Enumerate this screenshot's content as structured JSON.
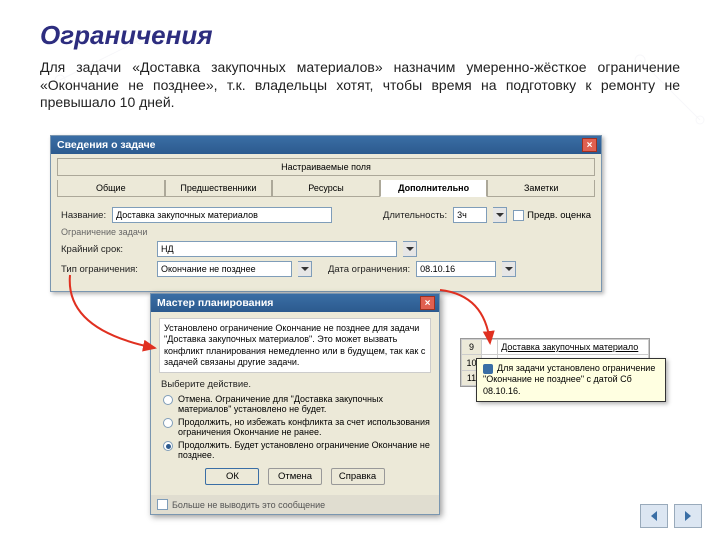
{
  "slide": {
    "title": "Ограничения",
    "subtitle": "Для задачи «Доставка закупочных материалов» назначим умеренно-жёсткое ограничение «Окончание не позднее», т.к. владельцы хотят, чтобы время на подготовку к ремонту не превышало 10 дней."
  },
  "taskDialog": {
    "title": "Сведения о задаче",
    "tabs": {
      "custom": "Настраиваемые поля",
      "general": "Общие",
      "pred": "Предшественники",
      "res": "Ресурсы",
      "adv": "Дополнительно",
      "notes": "Заметки"
    },
    "labels": {
      "name": "Название:",
      "duration": "Длительность:",
      "duration_val": "3ч",
      "pred_chk": "Предв. оценка",
      "group": "Ограничение задачи",
      "deadline": "Крайний срок:",
      "deadline_val": "НД",
      "ctype": "Тип ограничения:",
      "ctype_val": "Окончание не позднее",
      "cdate": "Дата ограничения:",
      "cdate_val": "08.10.16"
    },
    "name_val": "Доставка закупочных материалов"
  },
  "wizard": {
    "title": "Мастер планирования",
    "msg": "Установлено ограничение Окончание не позднее для задачи \"Доставка закупочных материалов\". Это может вызвать конфликт планирования немедленно или в будущем, так как с задачей связаны другие задачи.",
    "prompt": "Выберите действие.",
    "opt1": "Отмена. Ограничение для \"Доставка закупочных материалов\" установлено не будет.",
    "opt2": "Продолжить, но избежать конфликта за счет использования ограничения Окончание не ранее.",
    "opt3": "Продолжить. Будет установлено ограничение Окончание не позднее.",
    "ok": "ОК",
    "cancel": "Отмена",
    "help": "Справка",
    "dontshow": "Больше не выводить это сообщение"
  },
  "gantt": {
    "rows": [
      "9",
      "10",
      "11"
    ],
    "taskname": "Доставка закупочных материало"
  },
  "tooltip": {
    "text": "Для задачи установлено ограничение \"Окончание не позднее\" с датой Сб 08.10.16."
  }
}
